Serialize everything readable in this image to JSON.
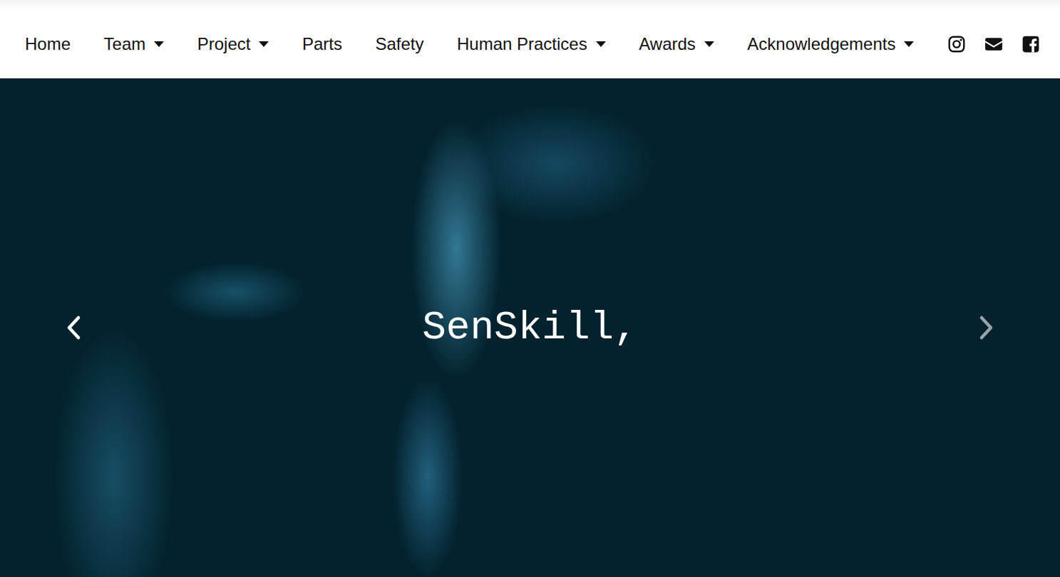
{
  "nav": {
    "items": [
      {
        "label": "Home",
        "dropdown": false
      },
      {
        "label": "Team",
        "dropdown": true
      },
      {
        "label": "Project",
        "dropdown": true
      },
      {
        "label": "Parts",
        "dropdown": false
      },
      {
        "label": "Safety",
        "dropdown": false
      },
      {
        "label": "Human Practices",
        "dropdown": true
      },
      {
        "label": "Awards",
        "dropdown": true
      },
      {
        "label": "Acknowledgements",
        "dropdown": true
      }
    ]
  },
  "hero": {
    "title": "SenSkill,"
  }
}
